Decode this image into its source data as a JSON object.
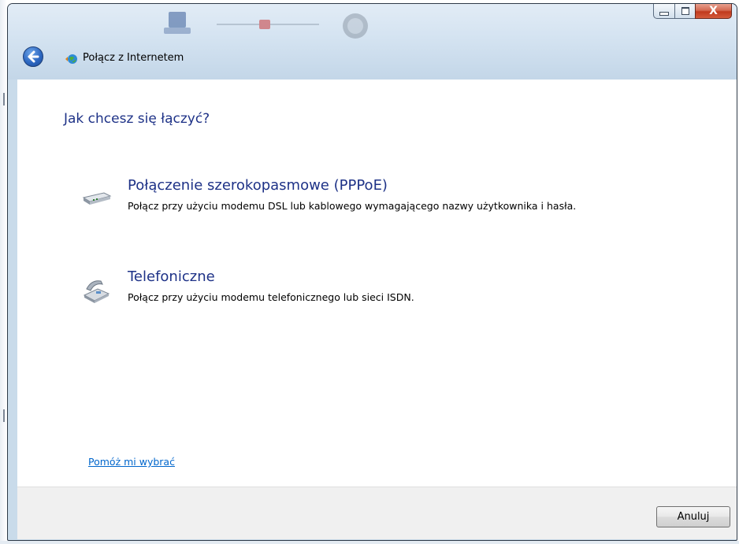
{
  "window": {
    "title": "Połącz z Internetem",
    "controls": {
      "minimize": "minimize",
      "maximize": "maximize",
      "close": "X"
    }
  },
  "page": {
    "heading": "Jak chcesz się łączyć?",
    "options": [
      {
        "title": "Połączenie szerokopasmowe (PPPoE)",
        "description": "Połącz przy użyciu modemu DSL lub kablowego wymagającego nazwy użytkownika i hasła.",
        "icon": "broadband-modem-icon"
      },
      {
        "title": "Telefoniczne",
        "description": "Połącz przy użyciu modemu telefonicznego lub sieci ISDN.",
        "icon": "dial-up-phone-icon"
      }
    ],
    "help_link": "Pomóż mi wybrać"
  },
  "footer": {
    "cancel_label": "Anuluj"
  },
  "colors": {
    "heading": "#1e3287",
    "link": "#0066cc",
    "glass": "#d4e3f1",
    "footer": "#f0f0f0",
    "close_button": "#c0391d"
  }
}
